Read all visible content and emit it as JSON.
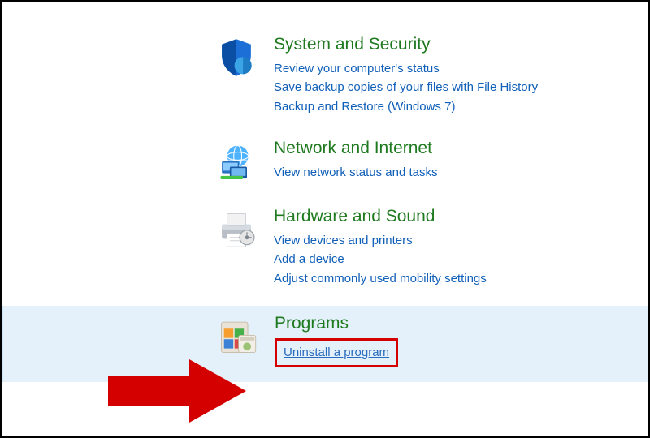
{
  "categories": [
    {
      "title": "System and Security",
      "links": [
        "Review your computer's status",
        "Save backup copies of your files with File History",
        "Backup and Restore (Windows 7)"
      ]
    },
    {
      "title": "Network and Internet",
      "links": [
        "View network status and tasks"
      ]
    },
    {
      "title": "Hardware and Sound",
      "links": [
        "View devices and printers",
        "Add a device",
        "Adjust commonly used mobility settings"
      ]
    },
    {
      "title": "Programs",
      "links": [
        "Uninstall a program"
      ]
    }
  ]
}
